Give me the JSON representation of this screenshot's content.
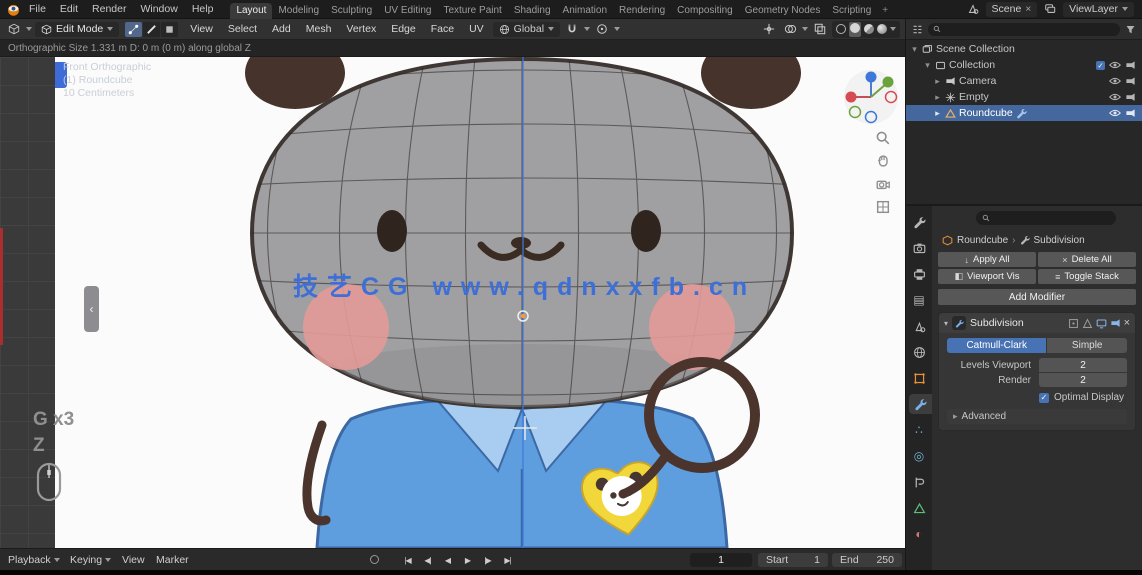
{
  "window": {
    "menus": [
      "File",
      "Edit",
      "Render",
      "Window",
      "Help"
    ],
    "workspaces": [
      "Layout",
      "Modeling",
      "Sculpting",
      "UV Editing",
      "Texture Paint",
      "Shading",
      "Animation",
      "Rendering",
      "Compositing",
      "Geometry Nodes",
      "Scripting"
    ],
    "new_workspace_label": "+",
    "scene": "Scene",
    "view_layer": "ViewLayer"
  },
  "header": {
    "mode": "Edit Mode",
    "menus": [
      "View",
      "Select",
      "Add",
      "Mesh",
      "Vertex",
      "Edge",
      "Face",
      "UV"
    ],
    "orientation": "Global"
  },
  "viewport": {
    "operator_hint": "Orthographic Size 1.331 m   D: 0 m (0 m) along global Z",
    "overlay": [
      "Front Orthographic",
      "(1) Roundcube",
      "10 Centimeters"
    ],
    "watermark": "技艺CG  www.qdnxxfb.cn",
    "screencast": [
      "G x3",
      "Z"
    ],
    "panel_tab_arrow": "‹"
  },
  "outliner": {
    "rows": [
      {
        "label": "Scene Collection"
      },
      {
        "label": "Collection"
      },
      {
        "label": "Camera"
      },
      {
        "label": "Empty"
      },
      {
        "label": "Roundcube"
      }
    ]
  },
  "properties": {
    "breadcrumb": {
      "object": "Roundcube",
      "separator": "›",
      "modifier": "Subdivision"
    },
    "tools": {
      "apply_all": "Apply All",
      "apply_all_icon": "↓",
      "delete_all": "Delete All",
      "delete_all_icon": "×",
      "viewport_vis": "Viewport Vis",
      "viewport_vis_icon": "◧",
      "toggle_stack": "Toggle Stack",
      "toggle_stack_icon": "≡"
    },
    "add_modifier": "Add Modifier",
    "modifier": {
      "name": "Subdivision",
      "catmull": "Catmull-Clark",
      "simple": "Simple",
      "levels_label": "Levels Viewport",
      "levels_value": "2",
      "render_label": "Render",
      "render_value": "2",
      "optimal": "Optimal Display",
      "optimal_check": "✓",
      "advanced_caret": "▸",
      "advanced": "Advanced",
      "close_icon": "×",
      "expand_caret": "▾"
    }
  },
  "timeline": {
    "menus": [
      "Playback",
      "Keying",
      "View",
      "Marker"
    ],
    "transport": [
      "|◀",
      "◀|",
      "◀",
      "▶",
      "|▶",
      "▶|"
    ],
    "frame": "1",
    "start_label": "Start",
    "start_value": "1",
    "end_label": "End",
    "end_value": "250"
  },
  "colors": {
    "accent": "#4772b3",
    "selection_row": "#44689e",
    "axis_z_blue": "#3f78dd",
    "watermark_blue": "#3e6fd6",
    "object_orange": "#e8913a"
  }
}
